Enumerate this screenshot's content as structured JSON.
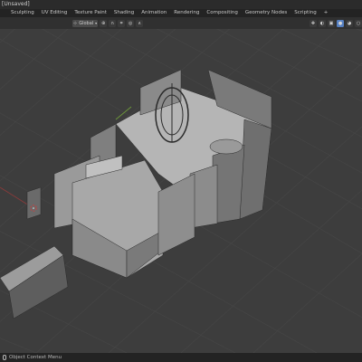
{
  "window": {
    "title": "[Unsaved]"
  },
  "workspaces": [
    "Sculpting",
    "UV Editing",
    "Texture Paint",
    "Shading",
    "Animation",
    "Rendering",
    "Compositing",
    "Geometry Nodes",
    "Scripting",
    "+"
  ],
  "toolbar": {
    "transform_orientation": "Global"
  },
  "statusbar": {
    "hint": "Object Context Menu"
  }
}
